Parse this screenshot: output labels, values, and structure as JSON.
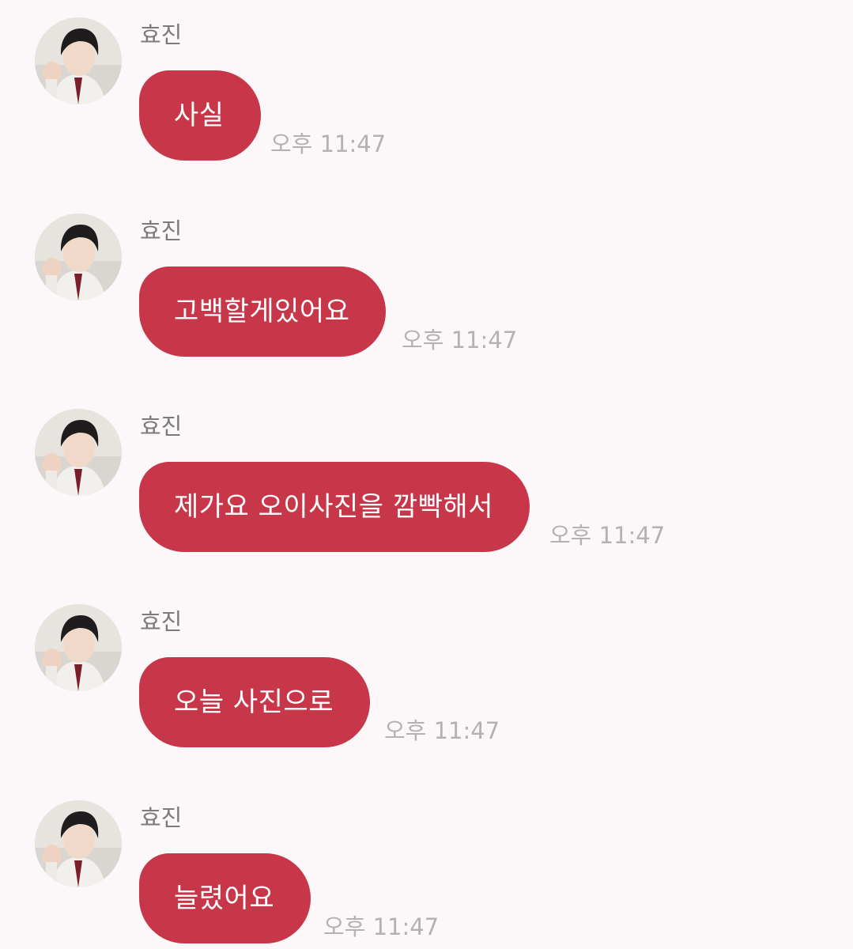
{
  "conversation": {
    "messages": [
      {
        "sender": "효진",
        "avatar": "profile-photo",
        "text": "사실",
        "time": "오후 11:47"
      },
      {
        "sender": "효진",
        "avatar": "profile-photo",
        "text": "고백할게있어요",
        "time": "오후 11:47"
      },
      {
        "sender": "효진",
        "avatar": "profile-photo",
        "text": "제가요 오이사진을 깜빡해서",
        "time": "오후 11:47"
      },
      {
        "sender": "효진",
        "avatar": "profile-photo",
        "text": "오늘 사진으로",
        "time": "오후 11:47"
      },
      {
        "sender": "효진",
        "avatar": "profile-photo",
        "text": "늘렸어요",
        "time": "오후 11:47"
      }
    ]
  },
  "colors": {
    "background": "#fcf8fa",
    "bubble": "#c83749",
    "bubble_text": "#ffffff",
    "sender_text": "#7d7a7c",
    "timestamp_text": "#b4b1b3"
  }
}
